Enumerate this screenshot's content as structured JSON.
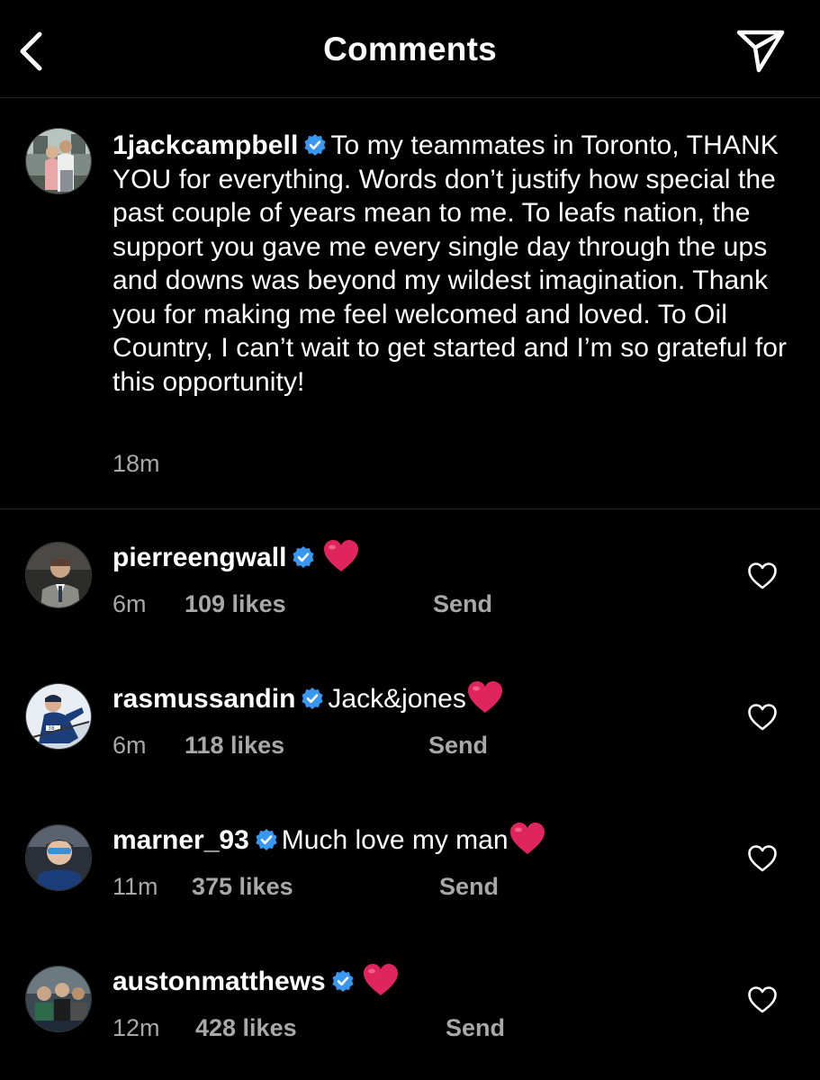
{
  "header": {
    "title": "Comments",
    "back_icon": "chevron-left-icon",
    "share_icon": "paper-plane-icon"
  },
  "caption": {
    "username": "1jackcampbell",
    "verified": true,
    "text": "To my teammates in Toronto, THANK YOU for everything. Words don’t justify how special the past couple of years mean to me. To leafs nation, the support you gave me every single day through the ups and downs was beyond my wildest imagination. Thank you for making me feel welcomed and loved. To Oil Country, I can’t wait to get started and I’m so grateful for this opportunity!",
    "time": "18m"
  },
  "comments": [
    {
      "username": "pierreengwall",
      "verified": true,
      "text": "",
      "emoji": "red-heart",
      "time": "6m",
      "likes": "109 likes",
      "send": "Send"
    },
    {
      "username": "rasmussandin",
      "verified": true,
      "text": "Jack&jones",
      "emoji": "red-heart",
      "time": "6m",
      "likes": "118 likes",
      "send": "Send"
    },
    {
      "username": "marner_93",
      "verified": true,
      "text": "Much love my man",
      "emoji": "red-heart",
      "time": "11m",
      "likes": "375 likes",
      "send": "Send"
    },
    {
      "username": "austonmatthews",
      "verified": true,
      "text": "",
      "emoji": "red-heart",
      "time": "12m",
      "likes": "428 likes",
      "send": "Send"
    }
  ],
  "colors": {
    "background": "#000000",
    "text": "#ffffff",
    "secondary_text": "#a8a8a8",
    "verified_badge": "#3897f0",
    "heart_emoji": "#e0245e",
    "divider": "#262626"
  }
}
